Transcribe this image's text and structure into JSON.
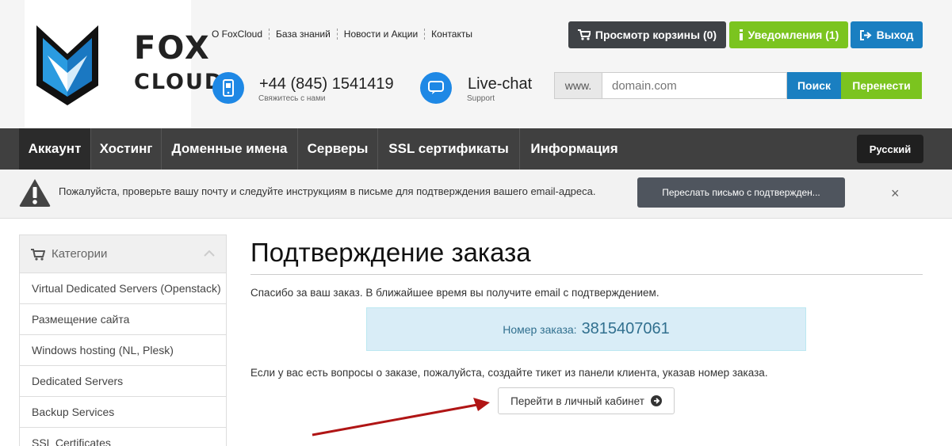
{
  "brand": {
    "line1": "FOX",
    "line2": "CLOUD"
  },
  "top_links": [
    "О FoxCloud",
    "База знаний",
    "Новости и Акции",
    "Контакты"
  ],
  "header_buttons": {
    "cart": "Просмотр корзины (0)",
    "notifications": "Уведомления (1)",
    "logout": "Выход"
  },
  "contacts": {
    "phone": "+44 (845) 1541419",
    "phone_sub": "Свяжитесь с нами",
    "chat": "Live-chat",
    "chat_sub": "Support"
  },
  "domain_search": {
    "prefix": "www.",
    "placeholder": "domain.com",
    "search_label": "Поиск",
    "transfer_label": "Перенести"
  },
  "nav": {
    "items": [
      "Аккаунт",
      "Хостинг",
      "Доменные имена",
      "Серверы",
      "SSL сертификаты",
      "Информация"
    ],
    "active": "Аккаунт",
    "language": "Русский"
  },
  "alert": {
    "text": "Пожалуйста, проверьте вашу почту и следуйте инструкциям в письме для подтверждения вашего email-адреса.",
    "resend_label": "Переслать письмо с подтвержден...",
    "close": "×"
  },
  "sidebar": {
    "title": "Категории",
    "items": [
      "Virtual Dedicated Servers (Openstack)",
      "Размещение сайта",
      "Windows hosting (NL, Plesk)",
      "Dedicated Servers",
      "Backup Services",
      "SSL Certificates"
    ]
  },
  "main": {
    "title": "Подтверждение заказа",
    "thanks": "Спасибо за ваш заказ. В ближайшее время вы получите email с подтверждением.",
    "order_label": "Номер заказа:",
    "order_number": "3815407061",
    "questions": "Если у вас есть вопросы о заказе, пожалуйста, создайте тикет из панели клиента, указав номер заказа.",
    "goto_label": "Перейти в личный кабинет"
  },
  "colors": {
    "cart_btn": "#3f4246",
    "notify_btn": "#7bc41f",
    "logout_btn": "#1a7fc1",
    "nav_bg": "#404040",
    "annotation_arrow": "#b01515"
  }
}
